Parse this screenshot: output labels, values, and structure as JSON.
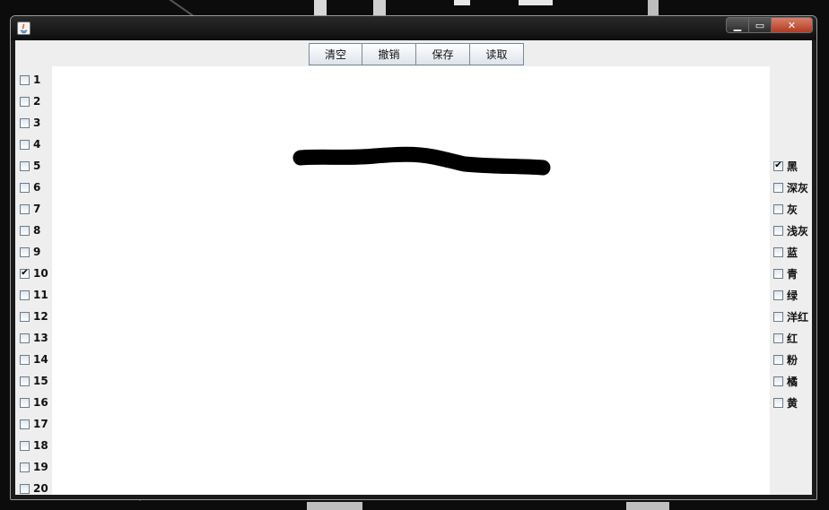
{
  "toolbar": {
    "buttons": [
      "清空",
      "撤销",
      "保存",
      "读取"
    ]
  },
  "sizes": {
    "items": [
      "1",
      "2",
      "3",
      "4",
      "5",
      "6",
      "7",
      "8",
      "9",
      "10",
      "11",
      "12",
      "13",
      "14",
      "15",
      "16",
      "17",
      "18",
      "19",
      "20"
    ],
    "selected": "10"
  },
  "colors": {
    "items": [
      "黑",
      "深灰",
      "灰",
      "浅灰",
      "蓝",
      "青",
      "绿",
      "洋红",
      "红",
      "粉",
      "橘",
      "黄"
    ],
    "selected": "黑"
  },
  "stroke_color": "#000000"
}
